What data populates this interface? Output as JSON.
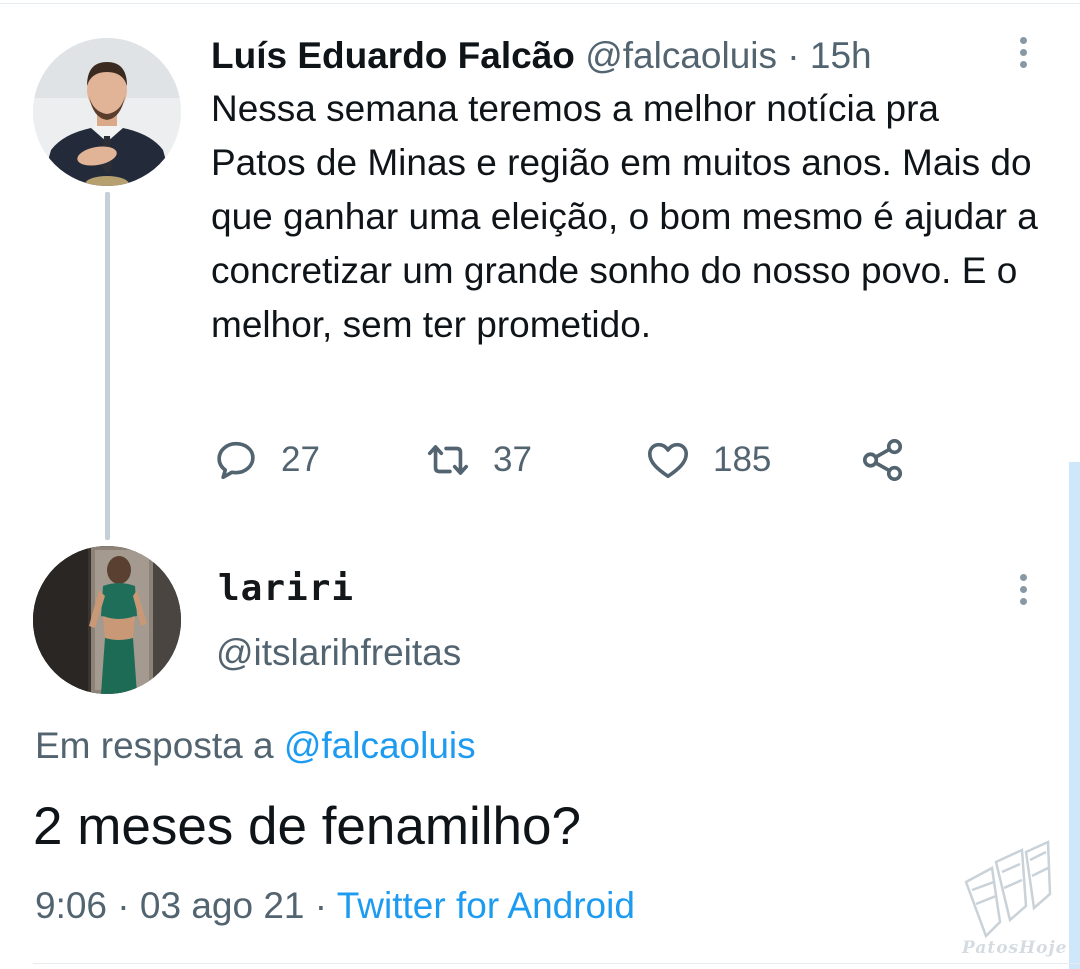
{
  "tweet": {
    "author_name": "Luís Eduardo Falcão",
    "author_handle": "@falcaoluis",
    "separator": "·",
    "time": "15h",
    "text": "Nessa semana teremos a melhor notícia pra Patos de Minas e região em muitos anos. Mais do que ganhar uma eleição, o bom mesmo é ajudar a concretizar um grande sonho do nosso povo. E o melhor, sem ter prometido.",
    "replies": "27",
    "retweets": "37",
    "likes": "185",
    "icons": [
      "reply-icon",
      "retweet-icon",
      "like-icon",
      "share-icon",
      "more-options-icon"
    ]
  },
  "reply": {
    "author_name": "lariri",
    "author_handle": "@itslarihfreitas",
    "in_reply_prefix": "Em resposta a",
    "in_reply_mention": "@falcaoluis",
    "text": "2 meses de fenamilho?",
    "time": "9:06",
    "separator1": "·",
    "date": "03 ago 21",
    "separator2": "·",
    "client": "Twitter for Android"
  },
  "watermark": {
    "text": "PatosHoje"
  },
  "colors": {
    "accent": "#1d9bf0",
    "secondary_text": "#536471",
    "primary_text": "#0f1419",
    "thread_line": "#c4cfd6"
  }
}
